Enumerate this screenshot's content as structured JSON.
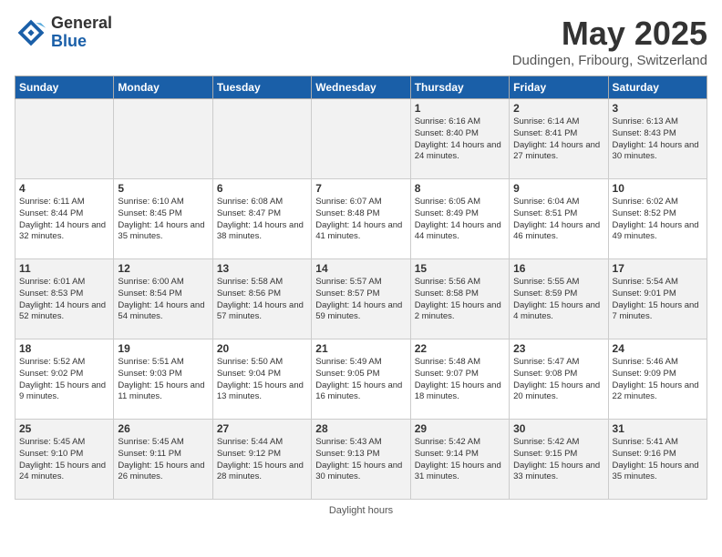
{
  "logo": {
    "general": "General",
    "blue": "Blue"
  },
  "title": "May 2025",
  "subtitle": "Dudingen, Fribourg, Switzerland",
  "days": [
    "Sunday",
    "Monday",
    "Tuesday",
    "Wednesday",
    "Thursday",
    "Friday",
    "Saturday"
  ],
  "weeks": [
    [
      {
        "num": "",
        "sunrise": "",
        "sunset": "",
        "daylight": ""
      },
      {
        "num": "",
        "sunrise": "",
        "sunset": "",
        "daylight": ""
      },
      {
        "num": "",
        "sunrise": "",
        "sunset": "",
        "daylight": ""
      },
      {
        "num": "",
        "sunrise": "",
        "sunset": "",
        "daylight": ""
      },
      {
        "num": "1",
        "sunrise": "6:16 AM",
        "sunset": "8:40 PM",
        "daylight": "14 hours and 24 minutes."
      },
      {
        "num": "2",
        "sunrise": "6:14 AM",
        "sunset": "8:41 PM",
        "daylight": "14 hours and 27 minutes."
      },
      {
        "num": "3",
        "sunrise": "6:13 AM",
        "sunset": "8:43 PM",
        "daylight": "14 hours and 30 minutes."
      }
    ],
    [
      {
        "num": "4",
        "sunrise": "6:11 AM",
        "sunset": "8:44 PM",
        "daylight": "14 hours and 32 minutes."
      },
      {
        "num": "5",
        "sunrise": "6:10 AM",
        "sunset": "8:45 PM",
        "daylight": "14 hours and 35 minutes."
      },
      {
        "num": "6",
        "sunrise": "6:08 AM",
        "sunset": "8:47 PM",
        "daylight": "14 hours and 38 minutes."
      },
      {
        "num": "7",
        "sunrise": "6:07 AM",
        "sunset": "8:48 PM",
        "daylight": "14 hours and 41 minutes."
      },
      {
        "num": "8",
        "sunrise": "6:05 AM",
        "sunset": "8:49 PM",
        "daylight": "14 hours and 44 minutes."
      },
      {
        "num": "9",
        "sunrise": "6:04 AM",
        "sunset": "8:51 PM",
        "daylight": "14 hours and 46 minutes."
      },
      {
        "num": "10",
        "sunrise": "6:02 AM",
        "sunset": "8:52 PM",
        "daylight": "14 hours and 49 minutes."
      }
    ],
    [
      {
        "num": "11",
        "sunrise": "6:01 AM",
        "sunset": "8:53 PM",
        "daylight": "14 hours and 52 minutes."
      },
      {
        "num": "12",
        "sunrise": "6:00 AM",
        "sunset": "8:54 PM",
        "daylight": "14 hours and 54 minutes."
      },
      {
        "num": "13",
        "sunrise": "5:58 AM",
        "sunset": "8:56 PM",
        "daylight": "14 hours and 57 minutes."
      },
      {
        "num": "14",
        "sunrise": "5:57 AM",
        "sunset": "8:57 PM",
        "daylight": "14 hours and 59 minutes."
      },
      {
        "num": "15",
        "sunrise": "5:56 AM",
        "sunset": "8:58 PM",
        "daylight": "15 hours and 2 minutes."
      },
      {
        "num": "16",
        "sunrise": "5:55 AM",
        "sunset": "8:59 PM",
        "daylight": "15 hours and 4 minutes."
      },
      {
        "num": "17",
        "sunrise": "5:54 AM",
        "sunset": "9:01 PM",
        "daylight": "15 hours and 7 minutes."
      }
    ],
    [
      {
        "num": "18",
        "sunrise": "5:52 AM",
        "sunset": "9:02 PM",
        "daylight": "15 hours and 9 minutes."
      },
      {
        "num": "19",
        "sunrise": "5:51 AM",
        "sunset": "9:03 PM",
        "daylight": "15 hours and 11 minutes."
      },
      {
        "num": "20",
        "sunrise": "5:50 AM",
        "sunset": "9:04 PM",
        "daylight": "15 hours and 13 minutes."
      },
      {
        "num": "21",
        "sunrise": "5:49 AM",
        "sunset": "9:05 PM",
        "daylight": "15 hours and 16 minutes."
      },
      {
        "num": "22",
        "sunrise": "5:48 AM",
        "sunset": "9:07 PM",
        "daylight": "15 hours and 18 minutes."
      },
      {
        "num": "23",
        "sunrise": "5:47 AM",
        "sunset": "9:08 PM",
        "daylight": "15 hours and 20 minutes."
      },
      {
        "num": "24",
        "sunrise": "5:46 AM",
        "sunset": "9:09 PM",
        "daylight": "15 hours and 22 minutes."
      }
    ],
    [
      {
        "num": "25",
        "sunrise": "5:45 AM",
        "sunset": "9:10 PM",
        "daylight": "15 hours and 24 minutes."
      },
      {
        "num": "26",
        "sunrise": "5:45 AM",
        "sunset": "9:11 PM",
        "daylight": "15 hours and 26 minutes."
      },
      {
        "num": "27",
        "sunrise": "5:44 AM",
        "sunset": "9:12 PM",
        "daylight": "15 hours and 28 minutes."
      },
      {
        "num": "28",
        "sunrise": "5:43 AM",
        "sunset": "9:13 PM",
        "daylight": "15 hours and 30 minutes."
      },
      {
        "num": "29",
        "sunrise": "5:42 AM",
        "sunset": "9:14 PM",
        "daylight": "15 hours and 31 minutes."
      },
      {
        "num": "30",
        "sunrise": "5:42 AM",
        "sunset": "9:15 PM",
        "daylight": "15 hours and 33 minutes."
      },
      {
        "num": "31",
        "sunrise": "5:41 AM",
        "sunset": "9:16 PM",
        "daylight": "15 hours and 35 minutes."
      }
    ]
  ],
  "footer": "Daylight hours"
}
